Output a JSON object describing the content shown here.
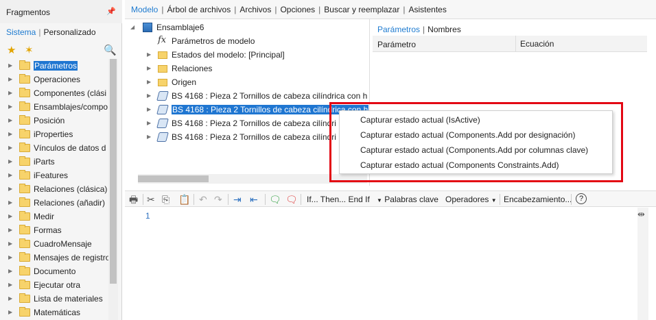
{
  "left_panel": {
    "title": "Fragmentos",
    "pin_icon": "pin-icon",
    "tabs": {
      "active": "Sistema",
      "other": "Personalizado"
    },
    "items": [
      "Parámetros",
      "Operaciones",
      "Componentes (clási",
      "Ensamblajes/compo",
      "Posición",
      "iProperties",
      "Vínculos de datos d",
      "iParts",
      "iFeatures",
      "Relaciones (clásica)",
      "Relaciones (añadir)",
      "Medir",
      "Formas",
      "CuadroMensaje",
      "Mensajes de registro",
      "Documento",
      "Ejecutar otra",
      "Lista de materiales",
      "Matemáticas"
    ],
    "selected_index": 0
  },
  "topnav": {
    "items": [
      "Modelo",
      "Árbol de archivos",
      "Archivos",
      "Opciones",
      "Buscar y reemplazar",
      "Asistentes"
    ],
    "active_index": 0
  },
  "tree": {
    "root": "Ensamblaje6",
    "model_params": "Parámetros de modelo",
    "model_states": "Estados del modelo: [Principal]",
    "relations": "Relaciones",
    "origin": "Origen",
    "parts": [
      "BS 4168 : Pieza 2 Tornillos de cabeza cilíndrica con h",
      "BS 4168 : Pieza 2 Tornillos de cabeza cilíndrica con h",
      "BS 4168 : Pieza 2 Tornillos de cabeza cilíndri",
      "BS 4168 : Pieza 2 Tornillos de cabeza cilíndri"
    ],
    "selected_part_index": 1
  },
  "params_panel": {
    "tabs": {
      "active": "Parámetros",
      "other": "Nombres"
    },
    "col1": "Parámetro",
    "col2": "Ecuación"
  },
  "toolbar": {
    "ifthen": "If... Then... End If",
    "keywords": "Palabras clave",
    "operators": "Operadores",
    "header": "Encabezamiento...",
    "help": "?"
  },
  "editor": {
    "line_number": "1"
  },
  "context_menu": {
    "items": [
      "Capturar estado actual (IsActive)",
      "Capturar estado actual (Components.Add por designación)",
      "Capturar estado actual (Components.Add por columnas clave)",
      "Capturar estado actual (Components Constraints.Add)"
    ]
  },
  "colors": {
    "accent": "#1e7bd0",
    "selection": "#1f76d1",
    "highlight_box": "#e30613"
  }
}
